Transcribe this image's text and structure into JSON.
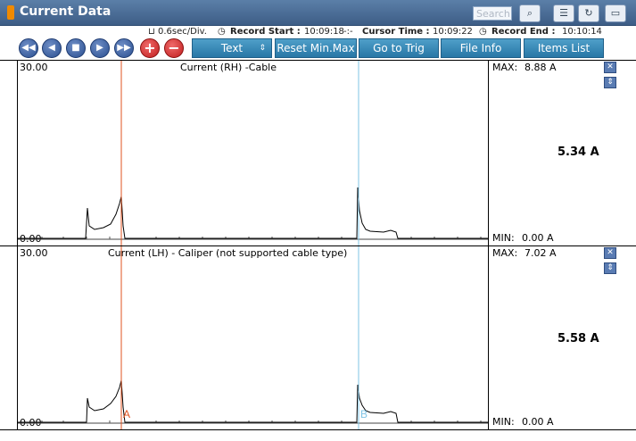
{
  "window": {
    "title": "Current Data",
    "search_placeholder": "Search"
  },
  "infobar": {
    "scale": "0.6sec/Div.",
    "record_start_label": "Record Start :",
    "record_start": "10:09:18",
    "cursor_time_label": "Cursor Time :",
    "cursor_time": "10:09:22",
    "record_end_label": "Record End :",
    "record_end": "10:10:14"
  },
  "toolbar": {
    "text_label": "Text",
    "reset_label": "Reset Min.Max",
    "trig_label": "Go to Trig",
    "fileinfo_label": "File Info",
    "items_label": "Items List"
  },
  "channels": [
    {
      "ymax": "30.00",
      "ymin": "0.00",
      "name": "Current (RH) -Cable",
      "max_label": "MAX:",
      "max": "8.88 A",
      "min_label": "MIN:",
      "min": "0.00 A",
      "value": "5.34 A"
    },
    {
      "ymax": "30.00",
      "ymin": "0.00",
      "name": "Current (LH) - Caliper (not supported cable type)",
      "max_label": "MAX:",
      "max": "7.02 A",
      "min_label": "MIN:",
      "min": "0.00 A",
      "value": "5.58 A"
    }
  ],
  "cursors": {
    "a": "A",
    "b": "B"
  },
  "colors": {
    "cursor_a": "#e0531f",
    "cursor_b": "#7fc4e6",
    "title_bg": "#4a6d98",
    "button_bg": "#2f82b1"
  }
}
